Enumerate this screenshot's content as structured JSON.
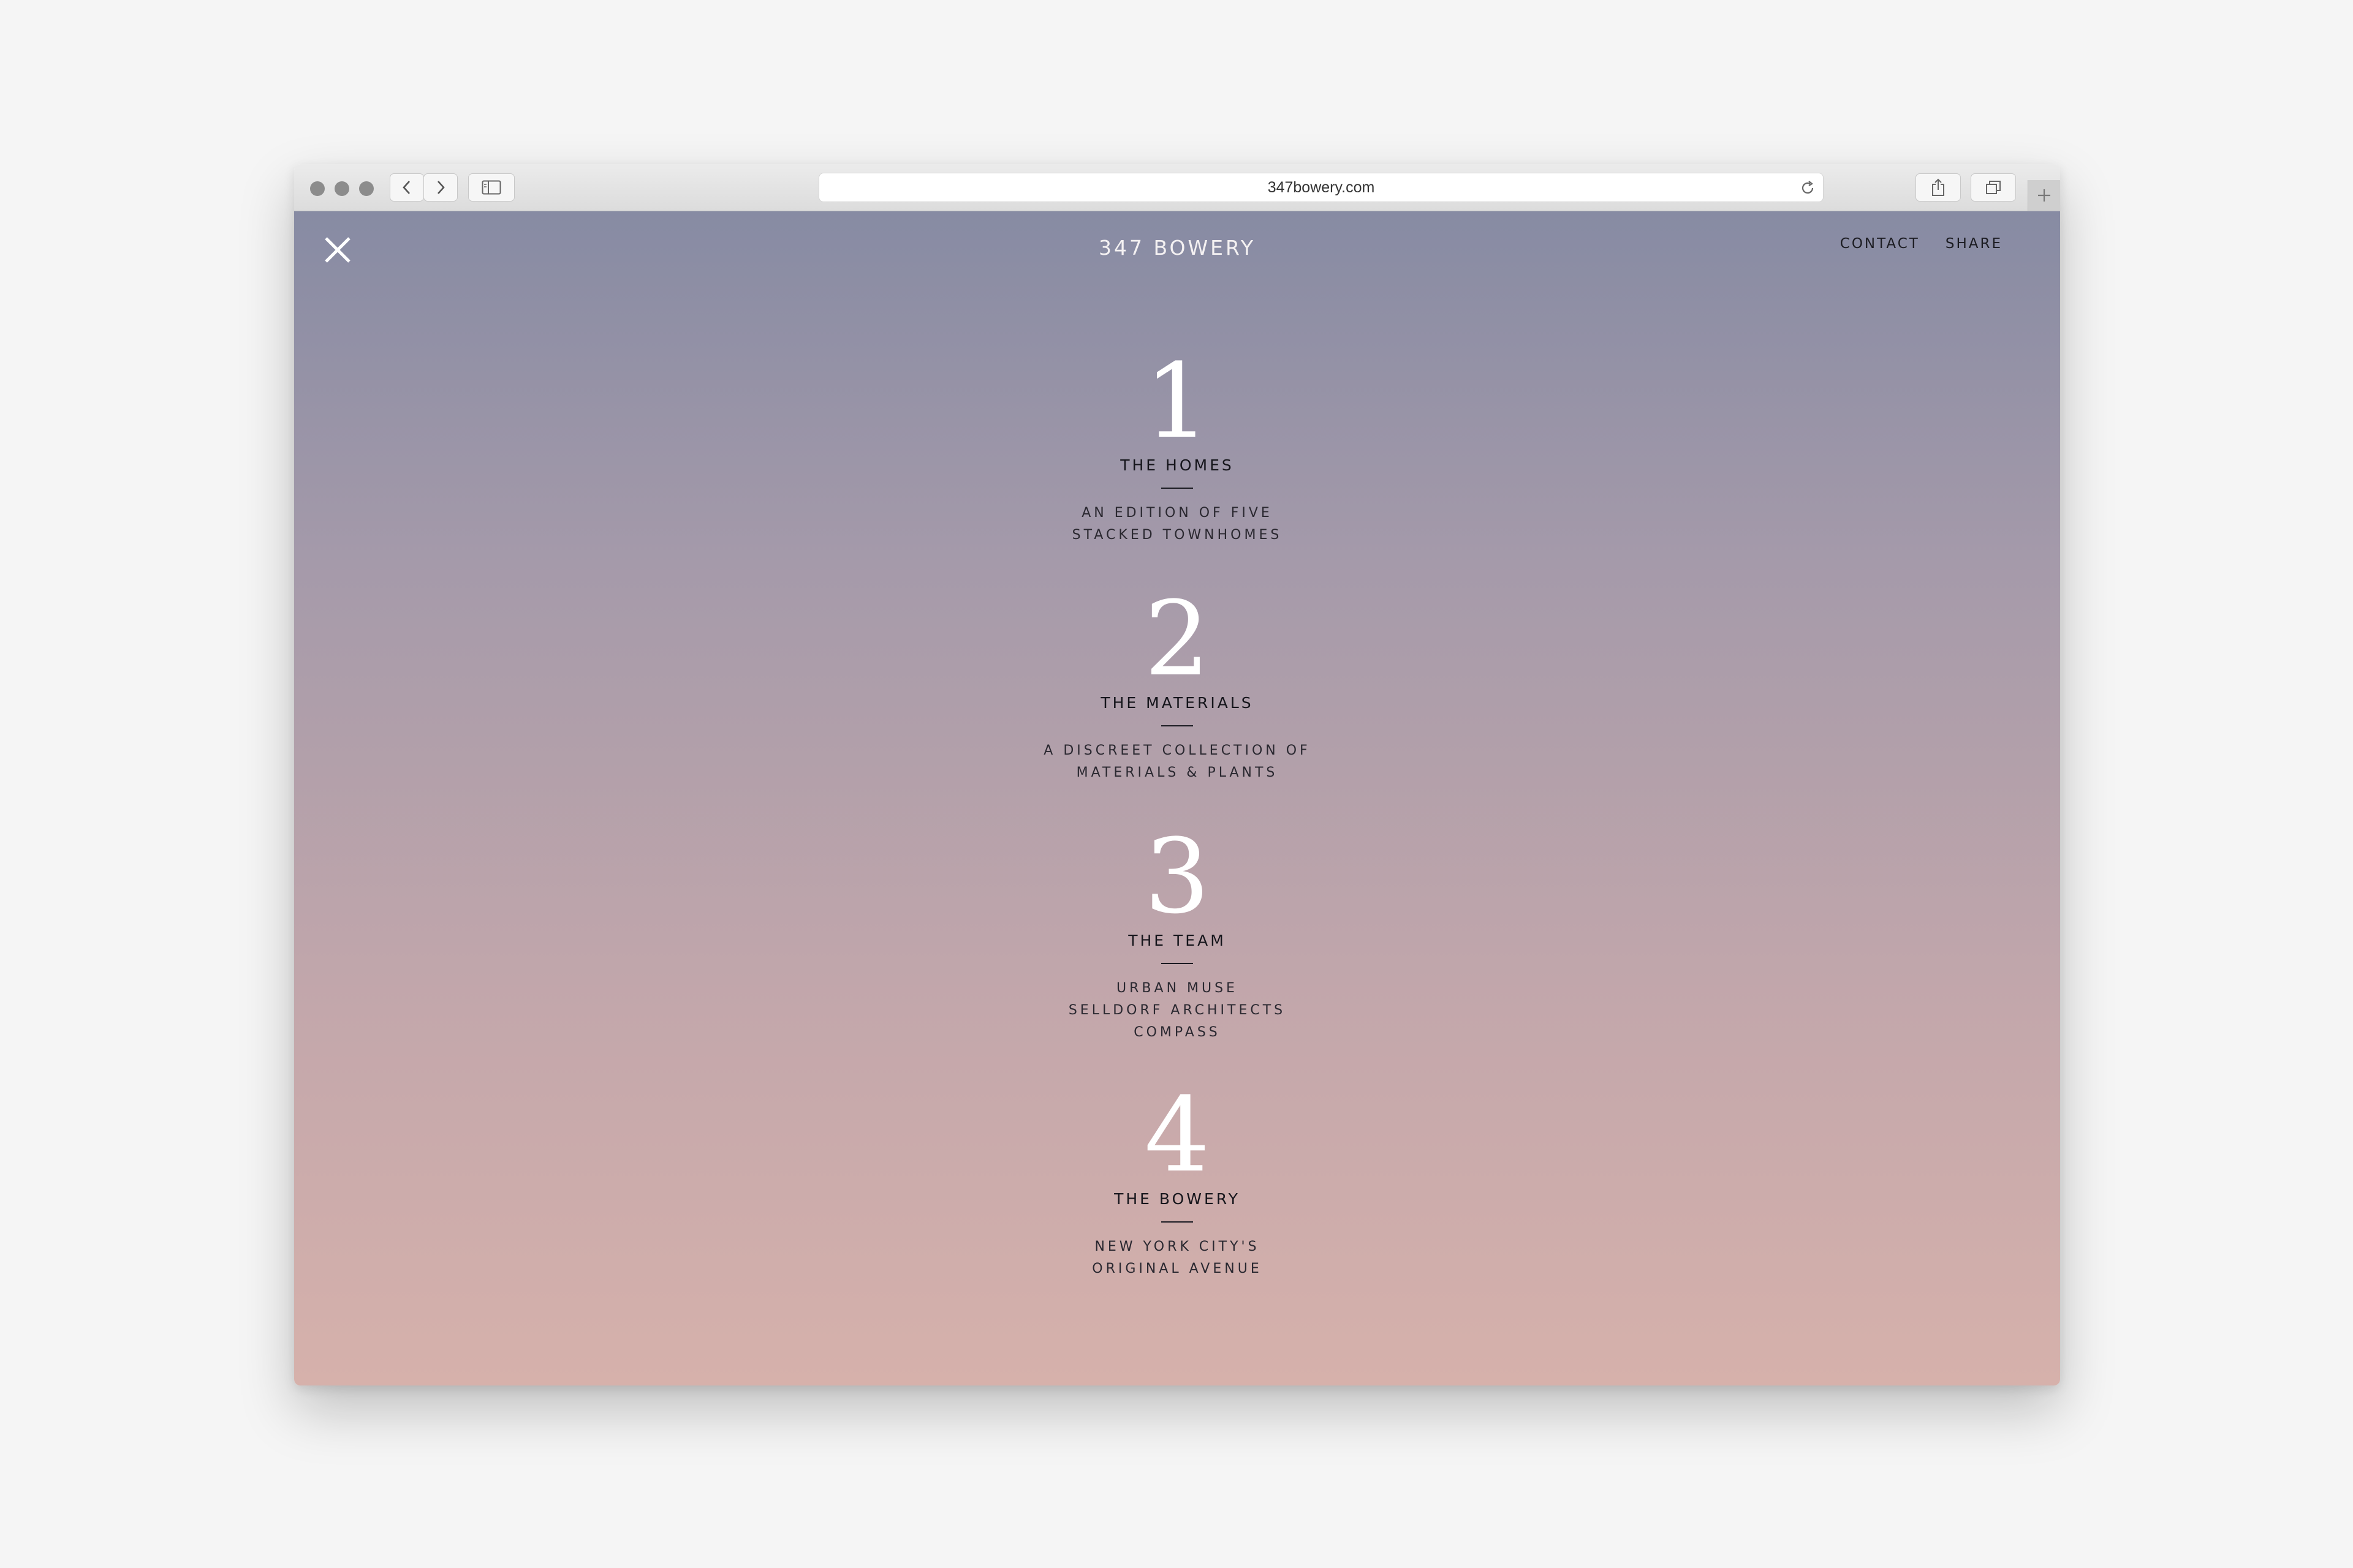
{
  "browser": {
    "url": "347bowery.com"
  },
  "header": {
    "site_title": "347 BOWERY",
    "nav": {
      "contact": "CONTACT",
      "share": "SHARE"
    }
  },
  "sections": [
    {
      "number": "1",
      "title": "THE HOMES",
      "lines": [
        "AN EDITION OF FIVE",
        "STACKED TOWNHOMES"
      ]
    },
    {
      "number": "2",
      "title": "THE MATERIALS",
      "lines": [
        "A DISCREET COLLECTION OF",
        "MATERIALS & PLANTS"
      ]
    },
    {
      "number": "3",
      "title": "THE TEAM",
      "lines": [
        "URBAN MUSE",
        "SELLDORF ARCHITECTS",
        "COMPASS"
      ]
    },
    {
      "number": "4",
      "title": "THE BOWERY",
      "lines": [
        "NEW YORK CITY'S",
        "ORIGINAL AVENUE"
      ]
    }
  ],
  "colors": {
    "gradient_top": "#878ba3",
    "gradient_bottom": "#d6b1ab",
    "text_dark": "#15151b",
    "numeral": "#ffffff"
  }
}
